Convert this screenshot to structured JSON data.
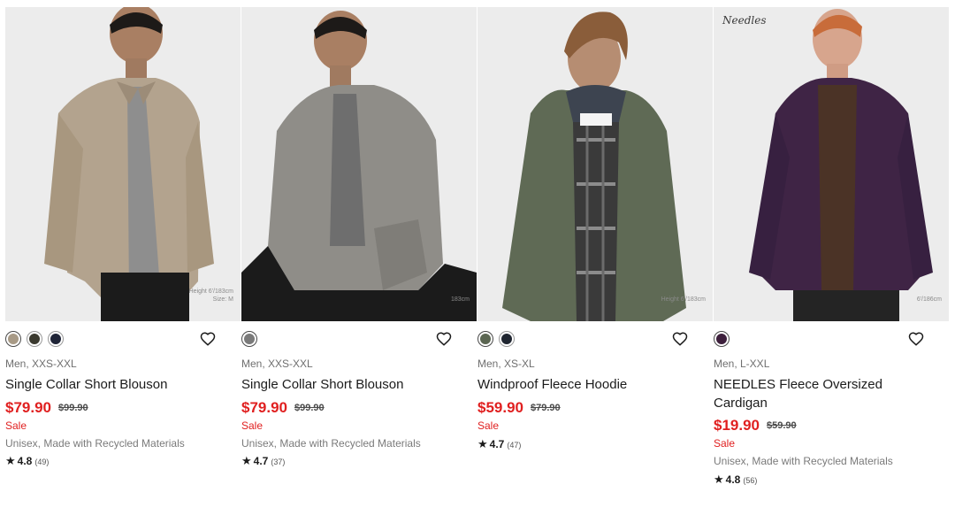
{
  "products": [
    {
      "gender_size": "Men, XXS-XXL",
      "name": "Single Collar Short Blouson",
      "price": "$79.90",
      "original_price": "$99.90",
      "sale_label": "Sale",
      "description": "Unisex, Made with Recycled Materials",
      "rating": "4.8",
      "review_count": "(49)",
      "model_info": "Height 6'/183cm\nSize: M",
      "swatches": [
        "#a89a86",
        "#3b3a2f",
        "#1f2437"
      ],
      "selected_swatch": 0
    },
    {
      "gender_size": "Men, XXS-XXL",
      "name": "Single Collar Short Blouson",
      "price": "$79.90",
      "original_price": "$99.90",
      "sale_label": "Sale",
      "description": "Unisex, Made with Recycled Materials",
      "rating": "4.7",
      "review_count": "(37)",
      "model_info": "183cm",
      "swatches": [
        "#7a7a7a"
      ],
      "selected_swatch": 0
    },
    {
      "gender_size": "Men, XS-XL",
      "name": "Windproof Fleece Hoodie",
      "price": "$59.90",
      "original_price": "$79.90",
      "sale_label": "Sale",
      "description": "",
      "rating": "4.7",
      "review_count": "(47)",
      "model_info": "Height 6'/183cm",
      "swatches": [
        "#5b6652",
        "#1f2530"
      ],
      "selected_swatch": 0
    },
    {
      "gender_size": "Men, L-XXL",
      "name": "NEEDLES Fleece Oversized Cardigan",
      "price": "$19.90",
      "original_price": "$59.90",
      "sale_label": "Sale",
      "description": "Unisex, Made with Recycled Materials",
      "rating": "4.8",
      "review_count": "(56)",
      "model_info": "6'/186cm",
      "brand_mark": "Needles",
      "swatches": [
        "#3d1f3c"
      ],
      "selected_swatch": 0
    }
  ],
  "colors": {
    "sale_red": "#e02020",
    "text_dark": "#1b1b1b",
    "text_gray": "#6f6f6f"
  }
}
